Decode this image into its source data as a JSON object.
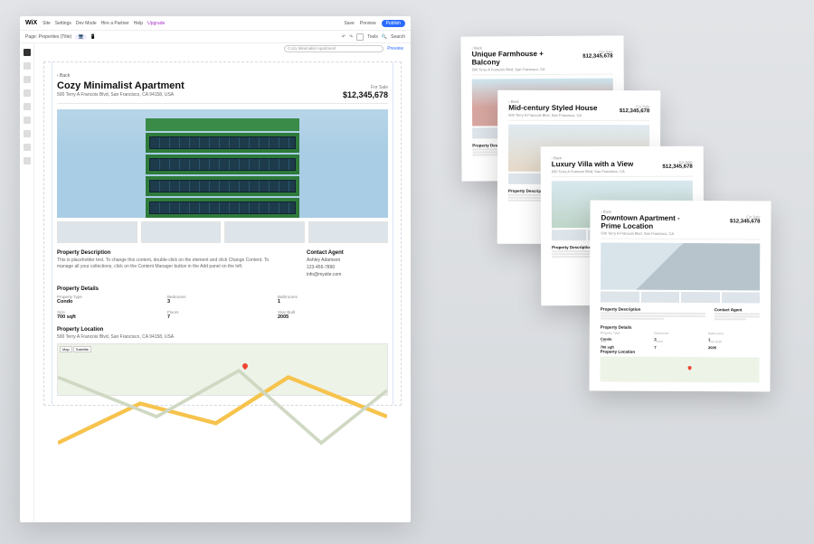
{
  "topbar": {
    "logo": "WiX",
    "menu": [
      "Site",
      "Settings",
      "Dev Mode",
      "Hire a Partner",
      "Help",
      "Upgrade"
    ],
    "save": "Save",
    "preview": "Preview",
    "publish": "Publish"
  },
  "subbar": {
    "page_label": "Page: Properties (Title)",
    "tools_label": "Tools",
    "search_placeholder": "Search"
  },
  "rail_icons": [
    "add",
    "pages",
    "design",
    "apps",
    "media",
    "data",
    "bookings",
    "store",
    "blog"
  ],
  "pagebar": {
    "search_value": "Cozy Minimalist Apartment",
    "preview": "Preview"
  },
  "listing": {
    "back": "‹ Back",
    "title": "Cozy Minimalist Apartment",
    "address": "500 Terry A Francois Blvd, San Francisco, CA 94158, USA",
    "sale_label": "For Sale",
    "price": "$12,345,678",
    "desc_heading": "Property Description",
    "desc_body": "This is placeholder text. To change this content, double-click on the element and click Change Content. To manage all your collections, click on the Content Manager button in the Add panel on the left.",
    "contact_heading": "Contact Agent",
    "agent_name": "Ashley Adamson",
    "agent_phone": "123-456-7890",
    "agent_email": "info@mysite.com",
    "details_heading": "Property Details",
    "details": [
      {
        "label": "Property Type",
        "value": "Condo"
      },
      {
        "label": "Bedrooms",
        "value": "3"
      },
      {
        "label": "Bathrooms",
        "value": "1"
      },
      {
        "label": "Size",
        "value": "700 sqft"
      },
      {
        "label": "Floors",
        "value": "7"
      },
      {
        "label": "Year Built",
        "value": "2005"
      }
    ],
    "location_heading": "Property Location",
    "location_addr": "500 Terry A Francois Blvd, San Francisco, CA 94158, USA",
    "map_tabs": [
      "Map",
      "Satellite"
    ]
  },
  "dynamic_pages": [
    {
      "title": "Unique Farmhouse + Balcony",
      "price": "$12,345,678",
      "sale": "For Sale",
      "address": "500 Terry A Francois Blvd, San Francisco, CA"
    },
    {
      "title": "Mid-century Styled House",
      "price": "$12,345,678",
      "sale": "For Sale",
      "address": "500 Terry A Francois Blvd, San Francisco, CA"
    },
    {
      "title": "Luxury Villa with a View",
      "price": "$12,345,678",
      "sale": "For Sale",
      "address": "500 Terry A Francois Blvd, San Francisco, CA"
    },
    {
      "title": "Downtown Apartment - Prime Location",
      "price": "$12,345,678",
      "sale": "For Sale",
      "address": "500 Terry A Francois Blvd, San Francisco, CA"
    }
  ],
  "dp_headings": {
    "desc": "Property Description",
    "contact": "Contact Agent",
    "details": "Property Details",
    "location": "Property Location"
  }
}
